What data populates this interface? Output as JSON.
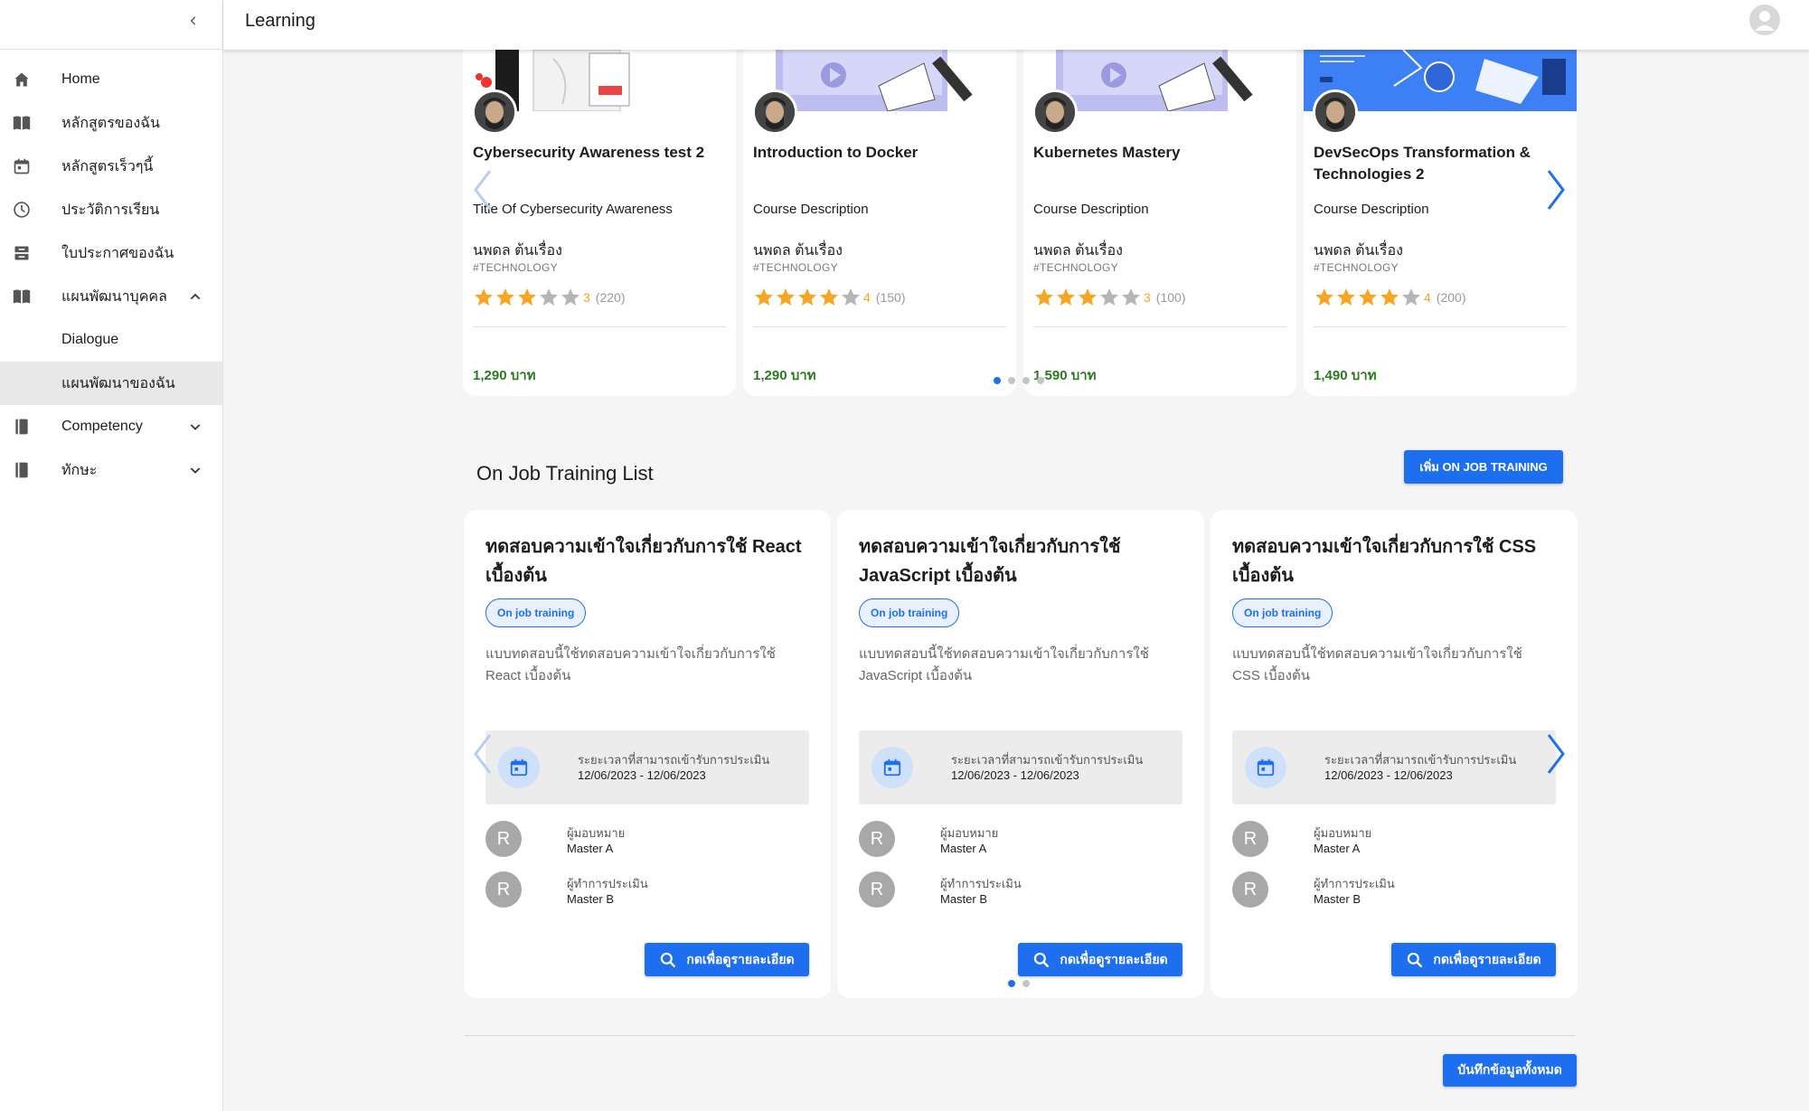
{
  "app": {
    "title": "Learning"
  },
  "sidebar": {
    "items": [
      {
        "label": "Home",
        "icon": "home-icon"
      },
      {
        "label": "หลักสูตรของฉัน",
        "icon": "book-open-icon"
      },
      {
        "label": "หลักสูตรเร็วๆนี้",
        "icon": "calendar-icon"
      },
      {
        "label": "ประวัติการเรียน",
        "icon": "clock-icon"
      },
      {
        "label": "ใบประกาศของฉัน",
        "icon": "inbox-icon"
      },
      {
        "label": "แผนพัฒนาบุคคล",
        "icon": "book-open-icon",
        "expanded": true
      },
      {
        "label": "Dialogue"
      },
      {
        "label": "แผนพัฒนาของฉัน",
        "active": true
      },
      {
        "label": "Competency",
        "icon": "book-icon",
        "expanded": false
      },
      {
        "label": "ทักษะ",
        "icon": "book-icon",
        "expanded": false
      }
    ]
  },
  "courses": [
    {
      "title": "Cybersecurity Awareness test 2",
      "description": "Title Of Cybersecurity Awareness",
      "author": "นพดล ต้นเรื่อง",
      "tag": "#TECHNOLOGY",
      "rating": 3,
      "rating_text": "3",
      "reviews": "(220)",
      "price": "1,290 บาท"
    },
    {
      "title": "Introduction to Docker",
      "description": "Course Description",
      "author": "นพดล ต้นเรื่อง",
      "tag": "#TECHNOLOGY",
      "rating": 4,
      "rating_text": "4",
      "reviews": "(150)",
      "price": "1,290 บาท"
    },
    {
      "title": "Kubernetes Mastery",
      "description": "Course Description",
      "author": "นพดล ต้นเรื่อง",
      "tag": "#TECHNOLOGY",
      "rating": 3,
      "rating_text": "3",
      "reviews": "(100)",
      "price": "1,590 บาท"
    },
    {
      "title": "DevSecOps Transformation & Technologies 2",
      "description": "Course Description",
      "author": "นพดล ต้นเรื่อง",
      "tag": "#TECHNOLOGY",
      "rating": 4,
      "rating_text": "4",
      "reviews": "(200)",
      "price": "1,490 บาท"
    }
  ],
  "ojt": {
    "heading": "On Job Training List",
    "add_button": "เพิ่ม ON JOB TRAINING",
    "cards": [
      {
        "title": "ทดสอบความเข้าใจเกี่ยวกับการใช้ React เบื้องต้น",
        "chip": "On job training",
        "description": "แบบทดสอบนี้ใช้ทดสอบความเข้าใจเกี่ยวกับการใช้ React เบื้องต้น",
        "period_label": "ระยะเวลาที่สามารถเข้ารับการประเมิน",
        "period_value": "12/06/2023 - 12/06/2023",
        "assigner_label": "ผู้มอบหมาย",
        "assigner": "Master A",
        "assigner_initial": "R",
        "evaluator_label": "ผู้ทำการประเมิน",
        "evaluator": "Master B",
        "evaluator_initial": "R",
        "button": "กดเพื่อดูรายละเอียด"
      },
      {
        "title": "ทดสอบความเข้าใจเกี่ยวกับการใช้ JavaScript เบื้องต้น",
        "chip": "On job training",
        "description": "แบบทดสอบนี้ใช้ทดสอบความเข้าใจเกี่ยวกับการใช้ JavaScript เบื้องต้น",
        "period_label": "ระยะเวลาที่สามารถเข้ารับการประเมิน",
        "period_value": "12/06/2023 - 12/06/2023",
        "assigner_label": "ผู้มอบหมาย",
        "assigner": "Master A",
        "assigner_initial": "R",
        "evaluator_label": "ผู้ทำการประเมิน",
        "evaluator": "Master B",
        "evaluator_initial": "R",
        "button": "กดเพื่อดูรายละเอียด"
      },
      {
        "title": "ทดสอบความเข้าใจเกี่ยวกับการใช้ CSS เบื้องต้น",
        "chip": "On job training",
        "description": "แบบทดสอบนี้ใช้ทดสอบความเข้าใจเกี่ยวกับการใช้ CSS เบื้องต้น",
        "period_label": "ระยะเวลาที่สามารถเข้ารับการประเมิน",
        "period_value": "12/06/2023 - 12/06/2023",
        "assigner_label": "ผู้มอบหมาย",
        "assigner": "Master A",
        "assigner_initial": "R",
        "evaluator_label": "ผู้ทำการประเมิน",
        "evaluator": "Master B",
        "evaluator_initial": "R",
        "button": "กดเพื่อดูรายละเอียด"
      }
    ]
  },
  "footer": {
    "save_button": "บันทึกข้อมูลทั้งหมด"
  },
  "colors": {
    "primary": "#1e6ff0",
    "price": "#2a7a1f",
    "star": "#f5a623"
  }
}
